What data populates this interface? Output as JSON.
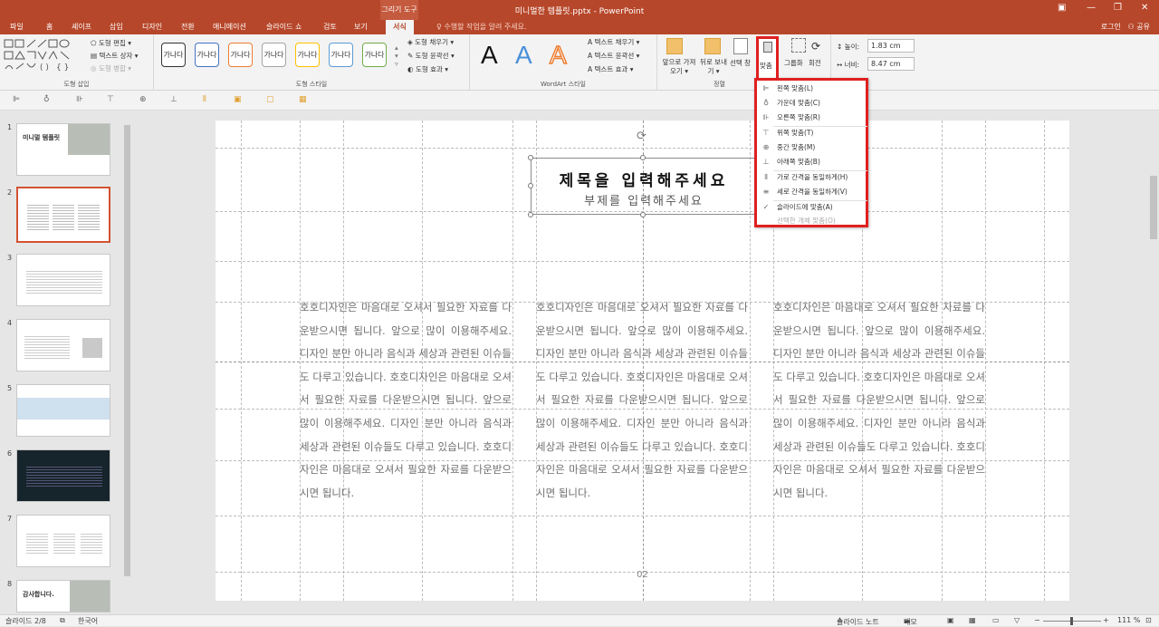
{
  "window": {
    "context_tab": "그리기 도구",
    "doc_title": "미니멀한 템플릿.pptx - PowerPoint"
  },
  "tabs": [
    "파일",
    "홈",
    "셰이프",
    "삽입",
    "디자인",
    "전환",
    "애니메이션",
    "슬라이드 쇼",
    "검토",
    "보기"
  ],
  "active_tab": "서식",
  "tell_me": "♀ 수행할 작업을 알려 주세요.",
  "login": "로그인",
  "share": "공유",
  "ribbon": {
    "insert_shapes": {
      "label": "도형 삽입",
      "edit_shape": "도형 편집 ▾",
      "text_box": "텍스트 상자 ▾",
      "merge_shapes": "도형 병합 ▾"
    },
    "shape_styles": {
      "label": "도형 스타일",
      "sample": "가나다",
      "fill": "도형 채우기 ▾",
      "outline": "도형 윤곽선 ▾",
      "effects": "도형 효과 ▾",
      "colors": [
        "#333333",
        "#4472c4",
        "#ed7d31",
        "#a5a5a5",
        "#ffc000",
        "#5b9bd5",
        "#70ad47"
      ]
    },
    "wordart": {
      "label": "WordArt 스타일",
      "text_fill": "텍스트 채우기 ▾",
      "text_outline": "텍스트 윤곽선 ▾",
      "text_effects": "텍스트 효과 ▾",
      "letter": "A"
    },
    "arrange": {
      "label": "정렬",
      "bring_forward": "앞으로 가져오기 ▾",
      "send_backward": "뒤로 보내기 ▾",
      "selection_pane": "선택 창",
      "align": "맞춤",
      "group": "그룹화",
      "rotate": "회전"
    },
    "size": {
      "height_label": "높이:",
      "height": "1.83 cm",
      "width_label": "너비:",
      "width": "8.47 cm"
    }
  },
  "align_menu": [
    {
      "icon": "align-left-icon",
      "glyph": "⊫",
      "label": "왼쪽 맞춤(L)",
      "enabled": true
    },
    {
      "icon": "align-center-icon",
      "glyph": "♁",
      "label": "가운데 맞춤(C)",
      "enabled": true
    },
    {
      "icon": "align-right-icon",
      "glyph": "⊪",
      "label": "오른쪽 맞춤(R)",
      "enabled": true
    },
    {
      "icon": "align-top-icon",
      "glyph": "⊤",
      "label": "위쪽 맞춤(T)",
      "enabled": true
    },
    {
      "icon": "align-middle-icon",
      "glyph": "⊕",
      "label": "중간 맞춤(M)",
      "enabled": true
    },
    {
      "icon": "align-bottom-icon",
      "glyph": "⊥",
      "label": "아래쪽 맞춤(B)",
      "enabled": true
    },
    {
      "icon": "distribute-horizontal-icon",
      "glyph": "⫴",
      "label": "가로 간격을 동일하게(H)",
      "enabled": true
    },
    {
      "icon": "distribute-vertical-icon",
      "glyph": "≡",
      "label": "세로 간격을 동일하게(V)",
      "enabled": true
    },
    {
      "icon": "checkmark-icon",
      "glyph": "✓",
      "label": "슬라이드에 맞춤(A)",
      "enabled": true
    },
    {
      "icon": "",
      "glyph": "",
      "label": "선택한 개체 맞춤(O)",
      "enabled": false
    }
  ],
  "slides": [
    {
      "num": "1"
    },
    {
      "num": "2"
    },
    {
      "num": "3"
    },
    {
      "num": "4"
    },
    {
      "num": "5"
    },
    {
      "num": "6"
    },
    {
      "num": "7"
    },
    {
      "num": "8"
    }
  ],
  "thumb_text": {
    "s1_title": "미니멀 템플릿",
    "s8_title": "감사합니다."
  },
  "slide": {
    "title": "제목을 입력해주세요",
    "subtitle": "부제를 입력해주세요",
    "body": "호호디자인은 마음대로 오셔서 필요한 자료를 다운받으시면 됩니다. 앞으로 많이 이용해주세요. 디자인 분만 아니라 음식과 세상과 관련된 이슈들도 다루고 있습니다. 호호디자인은 마음대로 오셔서 필요한 자료를 다운받으시면 됩니다. 앞으로 많이 이용해주세요. 디자인 분만 아니라 음식과 세상과 관련된 이슈들도 다루고 있습니다. 호호디자인은 마음대로 오셔서 필요한 자료를 다운받으시면 됩니다.",
    "page": "02"
  },
  "status": {
    "slide_info": "슬라이드 2/8",
    "language": "한국어",
    "notes": "슬라이드 노트",
    "comments": "메모",
    "zoom": "111 %"
  }
}
